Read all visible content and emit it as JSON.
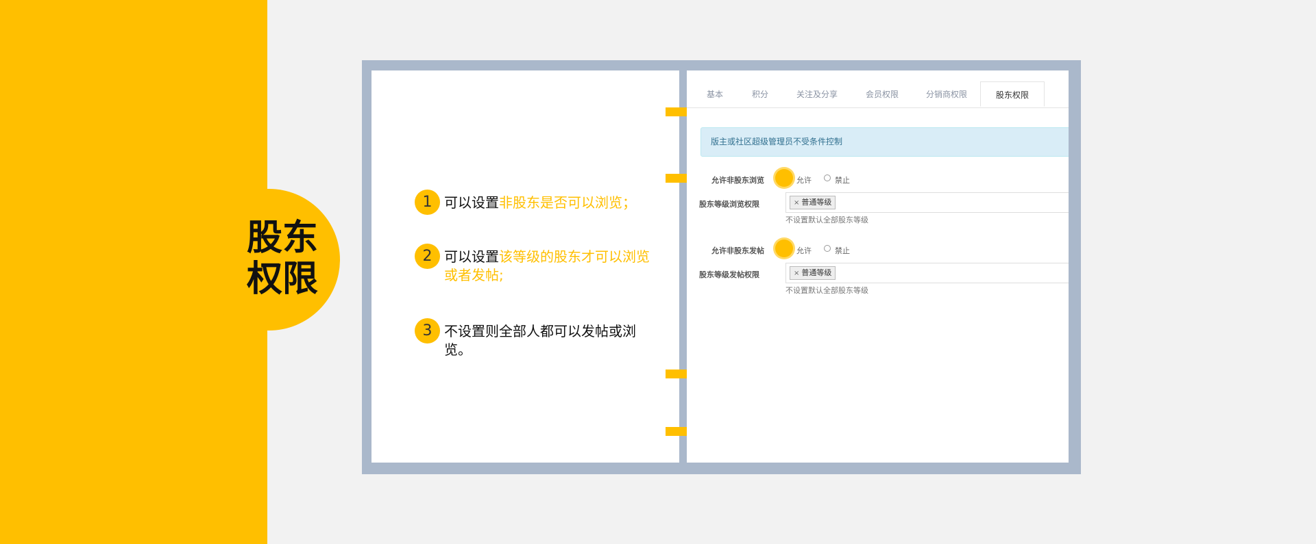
{
  "section_title": "股东权限",
  "steps": [
    {
      "num": "1",
      "prefix": "可以设置",
      "highlight": "非股东是否可以浏览；",
      "suffix": ""
    },
    {
      "num": "2",
      "prefix": "可以设置",
      "highlight": "该等级的股东才可以浏览或者发帖;",
      "suffix": ""
    },
    {
      "num": "3",
      "prefix": "不设置则全部人都可以发帖或浏览。",
      "highlight": "",
      "suffix": ""
    }
  ],
  "screenshot": {
    "tabs": [
      "基本",
      "积分",
      "关注及分享",
      "会员权限",
      "分销商权限",
      "股东权限"
    ],
    "active_tab": "股东权限",
    "notice": "版主或社区超级管理员不受条件控制",
    "rows": {
      "browse_label": "允许非股东浏览",
      "browse_allow": "允许",
      "browse_deny": "禁止",
      "browse_level_label": "股东等级浏览权限",
      "browse_level_tag": "普通等级",
      "browse_level_help": "不设置默认全部股东等级",
      "post_label": "允许非股东发帖",
      "post_allow": "允许",
      "post_deny": "禁止",
      "post_level_label": "股东等级发帖权限",
      "post_level_tag": "普通等级",
      "post_level_help": "不设置默认全部股东等级"
    },
    "tag_remove_glyph": "×"
  },
  "colors": {
    "accent": "#ffbf00",
    "binder": "#aab8cb",
    "background": "#f2f2f2"
  }
}
